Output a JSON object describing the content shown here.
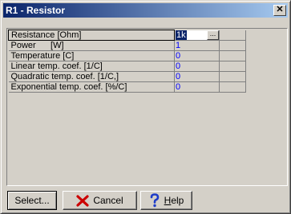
{
  "window": {
    "title": "R1 - Resistor",
    "close_glyph": "✕"
  },
  "grid": {
    "rows": [
      {
        "name": "Resistance [Ohm]",
        "value": "1k"
      },
      {
        "name": "Power      [W]",
        "value": "1"
      },
      {
        "name": "Temperature [C]",
        "value": "0"
      },
      {
        "name": "Linear temp. coef. [1/C]",
        "value": "0"
      },
      {
        "name": "Quadratic temp. coef. [1/C,]",
        "value": "0"
      },
      {
        "name": "Exponential temp. coef. [%/C]",
        "value": "0"
      }
    ],
    "ellipsis_label": "..."
  },
  "buttons": {
    "select_label": "Select...",
    "cancel_label": "Cancel",
    "help_prefix": "",
    "help_underline": "H",
    "help_rest": "elp"
  },
  "colors": {
    "title_start": "#0a246a",
    "title_end": "#a6caf0",
    "value_text": "#0000ff",
    "cancel_icon": "#cc0000",
    "help_icon": "#1e3cc8"
  }
}
